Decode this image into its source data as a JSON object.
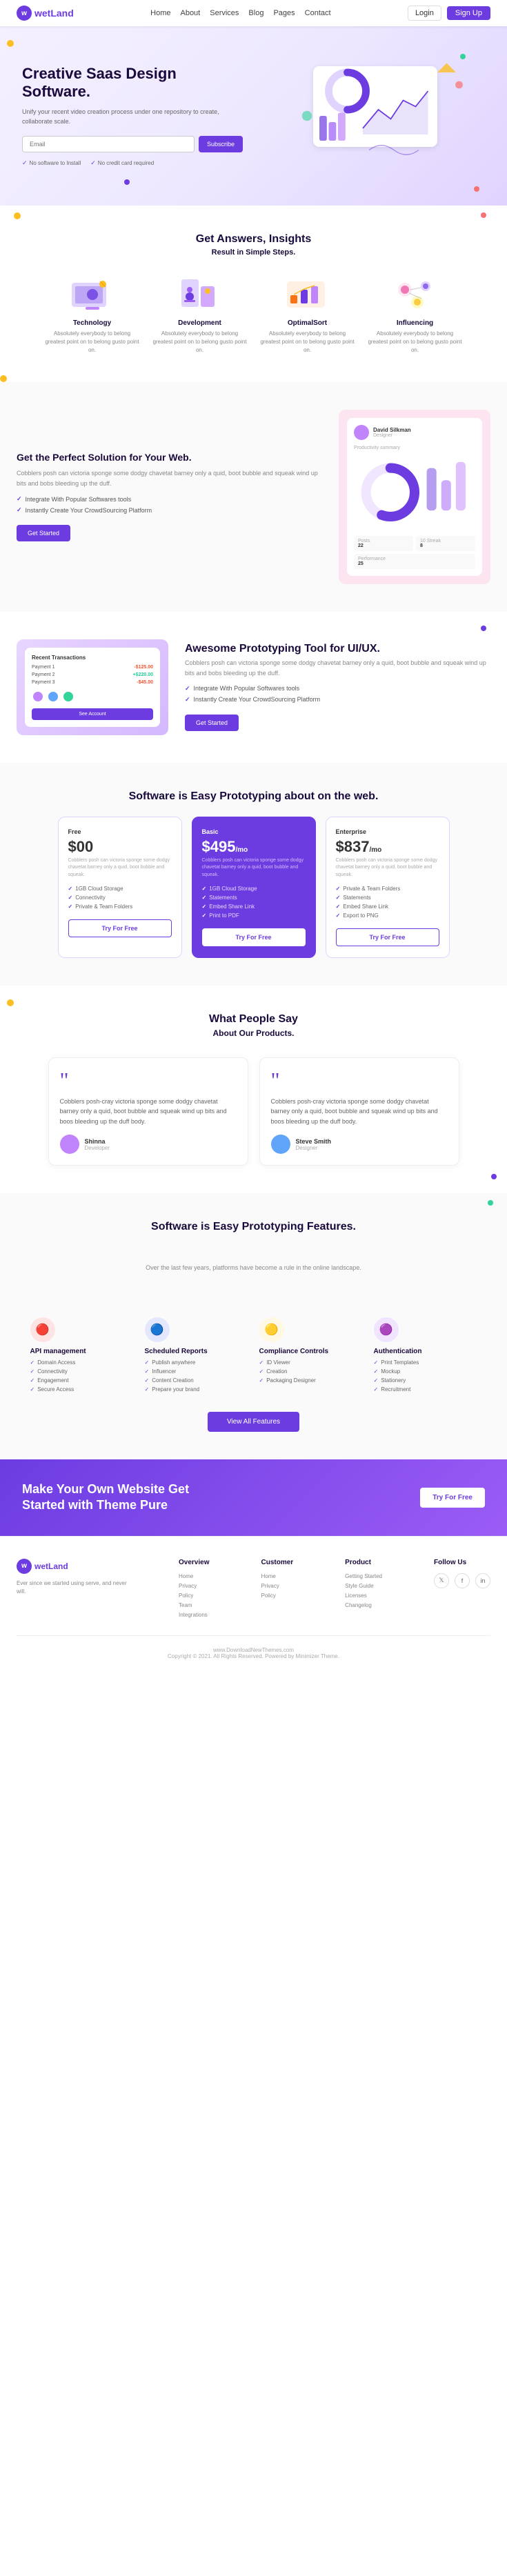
{
  "nav": {
    "logo": "wetLand",
    "links": [
      "Home",
      "About",
      "Services",
      "Blog",
      "Pages",
      "Contact"
    ],
    "login": "Login",
    "signup": "Sign Up"
  },
  "hero": {
    "title": "Creative Saas Design Software.",
    "subtitle": "Unify your recent video creation process under one repository to create, collaborate scale.",
    "input_placeholder": "Email",
    "subscribe_label": "Subscribe",
    "check1": "No software to Install",
    "check2": "No credit card required"
  },
  "steps": {
    "heading": "Get Answers, Insights",
    "subheading": "Result in Simple Steps.",
    "items": [
      {
        "title": "Technology",
        "desc": "Absolutely everybody to belong greatest point on to belong gusto point on."
      },
      {
        "title": "Development",
        "desc": "Absolutely everybody to belong greatest point on to belong gusto point on."
      },
      {
        "title": "OptimalSort",
        "desc": "Absolutely everybody to belong greatest point on to belong gusto point on."
      },
      {
        "title": "Influencing",
        "desc": "Absolutely everybody to belong greatest point on to belong gusto point on."
      }
    ]
  },
  "perfect": {
    "title": "Get the Perfect Solution for Your Web.",
    "desc": "Cobblers posh can victoria sponge some dodgy chavetat barney only a quid, boot bubble and squeak wind up bits and bobs bleeding up the duff.",
    "features": [
      "Integrate With Popular Softwares tools",
      "Instantly Create Your CrowdSourcing Platform"
    ],
    "cta": "Get Started",
    "mockup": {
      "name": "David Silkman",
      "role": "Designer",
      "summary_label": "Productivity summary",
      "stats": [
        {
          "label": "Posts",
          "value": "22"
        },
        {
          "label": "10 Streak",
          "value": "8"
        },
        {
          "label": "Performance",
          "value": "25"
        }
      ]
    }
  },
  "proto": {
    "title": "Awesome Prototyping Tool for UI/UX.",
    "desc": "Cobblers posh can victoria sponge some dodgy chavetat barney only a quid, boot bubble and squeak wind up bits and bobs bleeding up the duff.",
    "features": [
      "Integrate With Popular Softwares tools",
      "Instantly Create Your CrowdSourcing Platform"
    ],
    "cta": "Get Started",
    "transactions": {
      "title": "Recent Transactions",
      "items": [
        {
          "name": "Payment 1",
          "amount": "-$125.00",
          "type": "red"
        },
        {
          "name": "Payment 2",
          "amount": "+$220.00",
          "type": "green"
        },
        {
          "name": "Payment 3",
          "amount": "-$45.00",
          "type": "red"
        }
      ],
      "btn": "See Account"
    }
  },
  "pricing": {
    "title": "Software is Easy Prototyping about on the web.",
    "plans": [
      {
        "tier": "Free",
        "amount": "$00",
        "desc": "Cobblers posh can victoria sponge some dodgy chavetat barney only a quid, boot bubble and squeak.",
        "features": [
          "1GB Cloud Storage",
          "Connectivity",
          "Private & Team Folders"
        ],
        "cta": "Try For Free",
        "featured": false
      },
      {
        "tier": "Basic",
        "amount": "$495",
        "amount_suffix": "/mo",
        "desc": "Cobblers posh can victoria sponge some dodgy chavetat barney only a quid, boot bubble and squeak.",
        "features": [
          "1GB Cloud Storage",
          "Statements",
          "Embed Share Link",
          "Print to PDF"
        ],
        "cta": "Try For Free",
        "featured": true
      },
      {
        "tier": "Enterprise",
        "amount": "$837",
        "amount_suffix": "/mo",
        "desc": "Cobblers posh can victoria sponge some dodgy chavetat barney only a quid, boot bubble and squeak.",
        "features": [
          "Private & Team Folders",
          "Statements",
          "Embed Share Link",
          "Export to PNG"
        ],
        "cta": "Try For Free",
        "featured": false
      }
    ]
  },
  "testimonials": {
    "title": "What People Say",
    "subtitle": "About Our Products.",
    "items": [
      {
        "text": "Cobblers posh-cray victoria sponge some dodgy chavetat barney only a quid, boot bubble and squeak wind up bits and boos bleeding up the duff body.",
        "name": "Shinna",
        "role": "Developer",
        "avatar_color": "#c084fc"
      },
      {
        "text": "Cobblers posh-cray victoria sponge some dodgy chavetat barney only a quid, boot bubble and squeak wind up bits and boos bleeding up the duff body.",
        "name": "Steve Smith",
        "role": "Designer",
        "avatar_color": "#60a5fa"
      }
    ]
  },
  "features": {
    "title": "Software is Easy Prototyping Features.",
    "subtitle": "Over the last few years, platforms have become a rule in the online landscape.",
    "cards": [
      {
        "title": "API management",
        "icon": "🔴",
        "icon_bg": "#ffe4e4",
        "items": [
          "Domain Access",
          "Connectivity",
          "Engagement",
          "Secure Access"
        ]
      },
      {
        "title": "Scheduled Reports",
        "icon": "🔵",
        "icon_bg": "#e4e8ff",
        "items": [
          "Publish anywhere",
          "Influencer",
          "Content Creation",
          "Prepare your brand"
        ]
      },
      {
        "title": "Compliance Controls",
        "icon": "🟡",
        "icon_bg": "#fff9e4",
        "items": [
          "ID Viewer",
          "Creation",
          "Packaging Designer"
        ]
      },
      {
        "title": "Authentication",
        "icon": "🟣",
        "icon_bg": "#f0e4ff",
        "items": [
          "Print Templates",
          "Mockup",
          "Stationery",
          "Recruitment"
        ]
      }
    ],
    "cta": "View All Features"
  },
  "cta": {
    "title": "Make Your Own Website Get Started with Theme Pure",
    "button": "Try For Free"
  },
  "footer": {
    "logo": "wetLand",
    "brand_desc": "Ever since we started using serve, and never will.",
    "cols": [
      {
        "heading": "Overview",
        "links": [
          "Home",
          "Privacy",
          "Policy",
          "Team",
          "Integrations"
        ]
      },
      {
        "heading": "Customer",
        "links": [
          "Home",
          "Privacy",
          "Policy"
        ]
      },
      {
        "heading": "Product",
        "links": [
          "Getting Started",
          "Style Guide",
          "Licenses",
          "Changelog"
        ]
      },
      {
        "heading": "Follow Us",
        "links": []
      }
    ],
    "copyright": "www.DownloadNewThemes.com",
    "copyright2": "Copyright © 2021. All Rights Reserved. Powered by Minimizer Theme."
  },
  "colors": {
    "primary": "#6c3ce1",
    "accent": "#9b5cf6",
    "bg_light": "#fafafa",
    "text_dark": "#1a0a3c"
  }
}
